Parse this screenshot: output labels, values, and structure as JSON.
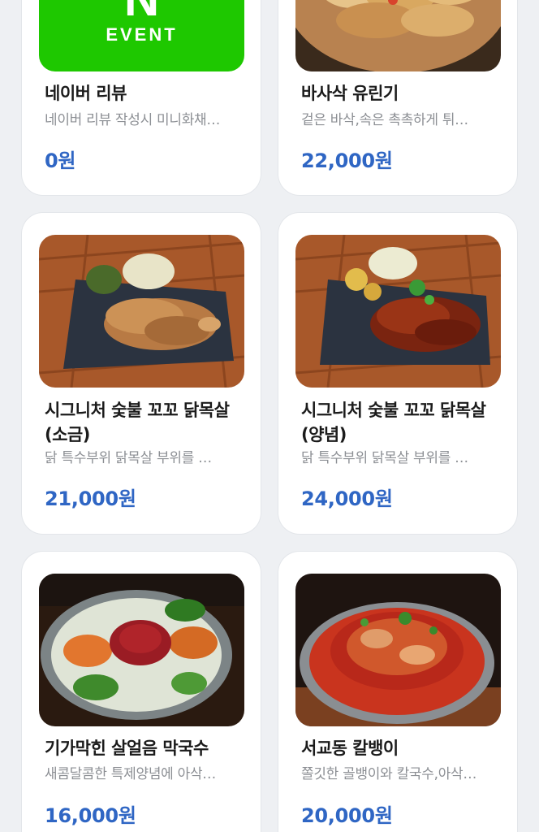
{
  "products": [
    {
      "title": "네이버 리뷰",
      "description": "네이버 리뷰 작성시 미니화채…",
      "price": "0원",
      "image": "naver-event-badge",
      "badge_text": "EVENT",
      "badge_letter": "N",
      "badge_color": "#1ec800"
    },
    {
      "title": "바사삭 유린기",
      "description": "겉은 바삭,속은 촉촉하게 튀…",
      "price": "22,000원",
      "image": "fried-chicken-photo"
    },
    {
      "title": "시그니처 숯불 꼬꼬 닭목살\n(소금)",
      "title_line1": "시그니처 숯불 꼬꼬 닭목살",
      "title_line2": "(소금)",
      "description": "닭 특수부위 닭목살 부위를 …",
      "price": "21,000원",
      "image": "grilled-chicken-neck-salt-photo"
    },
    {
      "title": "시그니처 숯불 꼬꼬 닭목살\n(양념)",
      "title_line1": "시그니처 숯불 꼬꼬 닭목살",
      "title_line2": "(양념)",
      "description": "닭 특수부위 닭목살 부위를 …",
      "price": "24,000원",
      "image": "grilled-chicken-neck-sauce-photo"
    },
    {
      "title": "기가막힌 살얼음 막국수",
      "description": "새콤달콤한 특제양념에 아삭…",
      "price": "16,000원",
      "image": "cold-buckwheat-noodles-photo"
    },
    {
      "title": "서교동 칼뱅이",
      "description": "쫄깃한 골뱅이와 칼국수,아삭…",
      "price": "20,000원",
      "image": "spicy-sea-snail-noodles-photo"
    }
  ],
  "colors": {
    "price": "#2f66c4",
    "background": "#eef0f3",
    "card": "#ffffff"
  }
}
